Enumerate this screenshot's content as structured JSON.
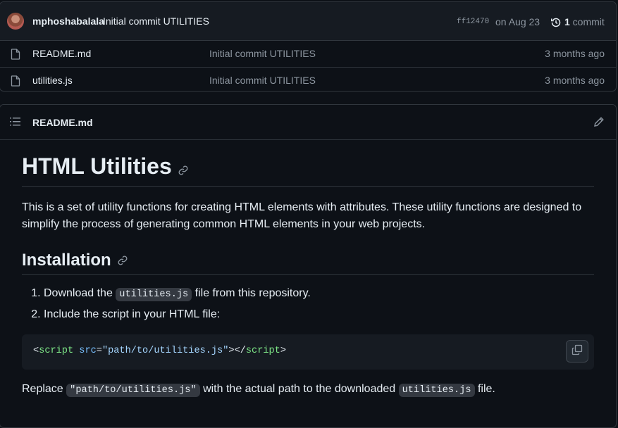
{
  "commit": {
    "author": "mphoshabalala",
    "message": "Initial commit UTILITIES",
    "sha": "ff12470",
    "date": "on Aug 23",
    "count": "1",
    "count_label": " commit"
  },
  "files": [
    {
      "name": "README.md",
      "message": "Initial commit UTILITIES",
      "age": "3 months ago",
      "icon": "file-icon"
    },
    {
      "name": "utilities.js",
      "message": "Initial commit UTILITIES",
      "age": "3 months ago",
      "icon": "file-icon"
    }
  ],
  "readme": {
    "file_label": "README.md",
    "title": "HTML Utilities",
    "intro": "This is a set of utility functions for creating HTML elements with attributes. These utility functions are designed to simplify the process of generating common HTML elements in your web projects.",
    "installation_heading": "Installation",
    "step1_before": "Download the ",
    "step1_code": "utilities.js",
    "step1_after": " file from this repository.",
    "step2": "Include the script in your HTML file:",
    "code": {
      "lt": "<",
      "tag_open": "script",
      "attr": " src",
      "eq": "=",
      "value": "\"path/to/utilities.js\"",
      "close": "></",
      "tag_close": "script",
      "gt": ">"
    },
    "replace_before": "Replace ",
    "replace_code": "\"path/to/utilities.js\"",
    "replace_middle": " with the actual path to the downloaded ",
    "replace_code2": "utilities.js",
    "replace_after": " file."
  },
  "colors": {
    "background": "#0d1117",
    "border": "#30363d",
    "muted": "#8d96a0",
    "code_tag": "#7ee787",
    "code_attr": "#79c0ff",
    "code_string": "#a5d6ff"
  }
}
